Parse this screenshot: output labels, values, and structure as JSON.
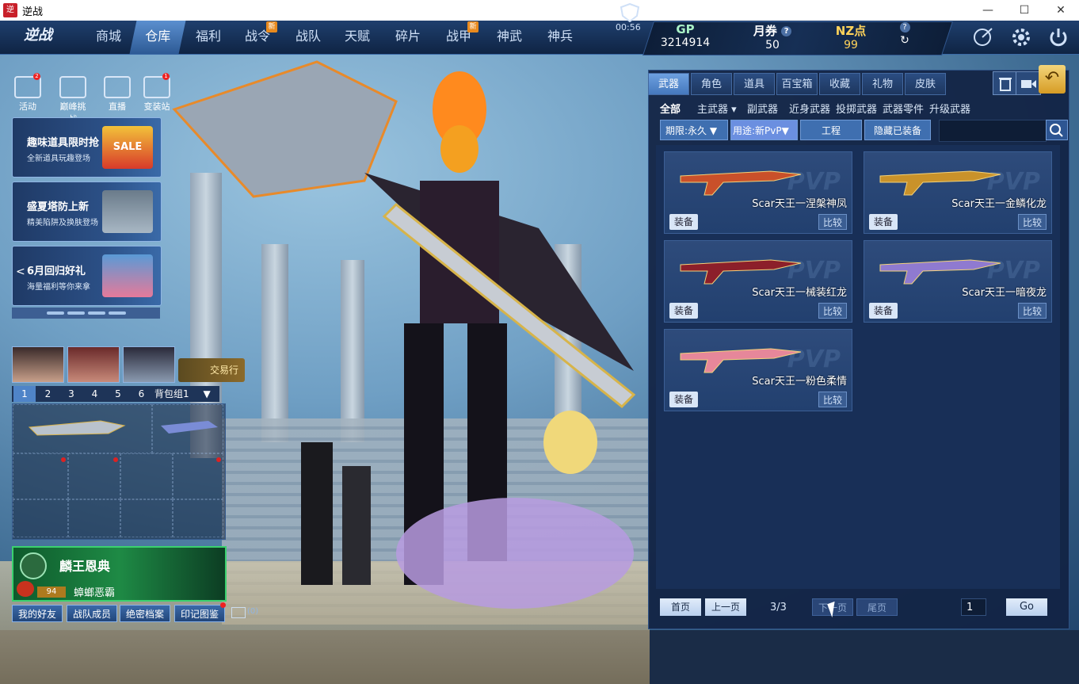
{
  "window": {
    "title": "逆战",
    "app_icon_text": "逆战",
    "min": "—",
    "max": "☐",
    "close": "✕"
  },
  "logo": "逆战",
  "nav": {
    "tabs": [
      {
        "label": "商城",
        "new": ""
      },
      {
        "label": "仓库",
        "new": ""
      },
      {
        "label": "福利",
        "new": ""
      },
      {
        "label": "战令",
        "new": "新"
      },
      {
        "label": "战队",
        "new": ""
      },
      {
        "label": "天赋",
        "new": ""
      },
      {
        "label": "碎片",
        "new": ""
      },
      {
        "label": "战甲",
        "new": "新"
      },
      {
        "label": "神武",
        "new": ""
      },
      {
        "label": "神兵",
        "new": ""
      }
    ],
    "timer": "00:56"
  },
  "currency": {
    "gp": {
      "label": "GP",
      "value": "3214914"
    },
    "ticket": {
      "label": "月券",
      "value": "50"
    },
    "nz": {
      "label": "NZ点",
      "value": "99"
    },
    "help": "?",
    "refresh": "↻"
  },
  "mini_icons": [
    {
      "label": "活动",
      "badge": "2"
    },
    {
      "label": "巅峰挑战",
      "badge": ""
    },
    {
      "label": "直播",
      "badge": ""
    },
    {
      "label": "变装站",
      "badge": "1"
    }
  ],
  "promos": [
    {
      "title": "趣味道具限时抢",
      "sub": "全新道具玩趣登场",
      "img": "SALE"
    },
    {
      "title": "盛夏塔防上新",
      "sub": "精美陷阱及换肤登场",
      "img": ""
    },
    {
      "title": "6月回归好礼",
      "sub": "海量福利等你来拿",
      "img": ""
    }
  ],
  "carousel_prev": "<",
  "trade_label": "交易行",
  "slot_tabs": [
    "1",
    "2",
    "3",
    "4",
    "5",
    "6"
  ],
  "slot_group": "背包组1",
  "slot_group_arrow": "▼",
  "kylin": {
    "title": "麟王恩典",
    "level": "94",
    "name": "蟑螂恶霸"
  },
  "bottom_buttons": [
    "我的好友",
    "战队成员",
    "绝密档案",
    "印记图鉴"
  ],
  "mail_count": "(0)",
  "panel": {
    "tabs": [
      "武器",
      "角色",
      "道具",
      "百宝箱",
      "收藏",
      "礼物",
      "皮肤"
    ],
    "back_icon": "↶",
    "subcats": [
      "全部",
      "主武器",
      "副武器",
      "近身武器",
      "投掷武器",
      "武器零件",
      "升级武器"
    ],
    "subcat_arrow": "▾",
    "filters": {
      "period": "期限:永久",
      "usage": "用途:新PvP",
      "engineering": "工程",
      "hide_equipped": "隐藏已装备",
      "arrow": "▼"
    },
    "search_placeholder": "",
    "items": [
      {
        "name": "Scar天王一涅槃神凤",
        "equip": "装备",
        "compare": "比较",
        "color": "#c9502a"
      },
      {
        "name": "Scar天王一金鳞化龙",
        "equip": "装备",
        "compare": "比较",
        "color": "#c9922a"
      },
      {
        "name": "Scar天王一械装红龙",
        "equip": "装备",
        "compare": "比较",
        "color": "#8c1f2a"
      },
      {
        "name": "Scar天王一暗夜龙",
        "equip": "装备",
        "compare": "比较",
        "color": "#8f7ad0"
      },
      {
        "name": "Scar天王一粉色柔情",
        "equip": "装备",
        "compare": "比较",
        "color": "#e6879a"
      }
    ],
    "watermark": "PVP",
    "pagination": {
      "first": "首页",
      "prev": "上一页",
      "info": "3/3",
      "next": "下一页",
      "last": "尾页",
      "input": "1",
      "go": "Go"
    }
  }
}
